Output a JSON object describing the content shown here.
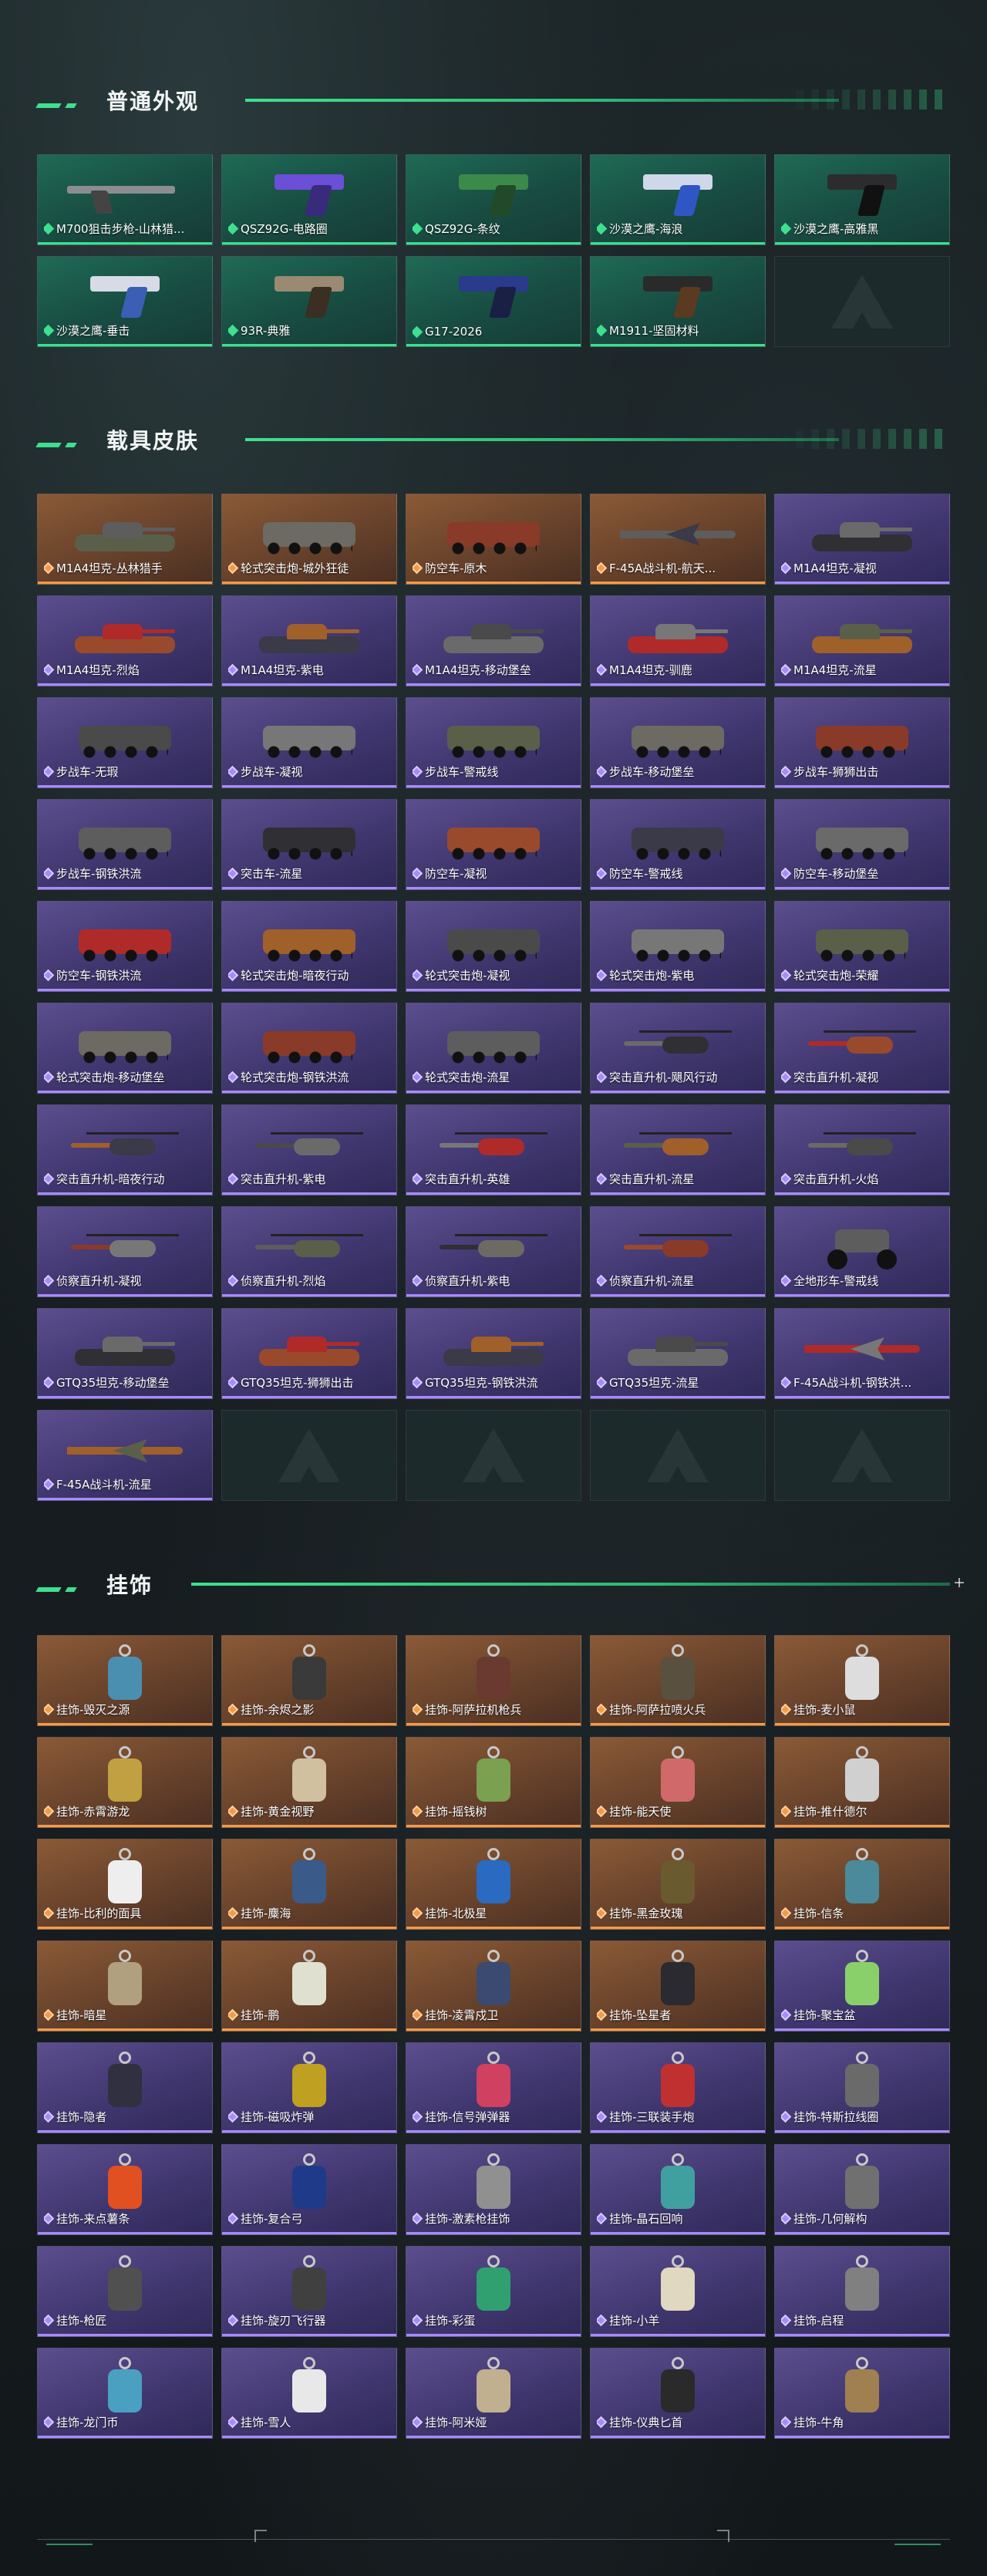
{
  "sections": {
    "weapon_skins": {
      "title": "普通外观",
      "items": [
        "M700狙击步枪-山林猎...",
        "QSZ92G-电路圈",
        "QSZ92G-条纹",
        "沙漠之鹰-海浪",
        "沙漠之鹰-高雅黑",
        "沙漠之鹰-垂击",
        "93R-典雅",
        "G17-2026",
        "M1911-坚固材料"
      ]
    },
    "vehicle_skins": {
      "title": "载具皮肤",
      "items": [
        {
          "label": "M1A4坦克-丛林猎手",
          "rarity": "orange"
        },
        {
          "label": "轮式突击炮-城外狂徒",
          "rarity": "orange"
        },
        {
          "label": "防空车-原木",
          "rarity": "orange"
        },
        {
          "label": "F-45A战斗机-航天...",
          "rarity": "orange"
        },
        {
          "label": "M1A4坦克-凝视",
          "rarity": "purple"
        },
        {
          "label": "M1A4坦克-烈焰",
          "rarity": "purple"
        },
        {
          "label": "M1A4坦克-紫电",
          "rarity": "purple"
        },
        {
          "label": "M1A4坦克-移动堡垒",
          "rarity": "purple"
        },
        {
          "label": "M1A4坦克-驯鹿",
          "rarity": "purple"
        },
        {
          "label": "M1A4坦克-流星",
          "rarity": "purple"
        },
        {
          "label": "步战车-无瑕",
          "rarity": "purple"
        },
        {
          "label": "步战车-凝视",
          "rarity": "purple"
        },
        {
          "label": "步战车-警戒线",
          "rarity": "purple"
        },
        {
          "label": "步战车-移动堡垒",
          "rarity": "purple"
        },
        {
          "label": "步战车-狮狮出击",
          "rarity": "purple"
        },
        {
          "label": "步战车-钢铁洪流",
          "rarity": "purple"
        },
        {
          "label": "突击车-流星",
          "rarity": "purple"
        },
        {
          "label": "防空车-凝视",
          "rarity": "purple"
        },
        {
          "label": "防空车-警戒线",
          "rarity": "purple"
        },
        {
          "label": "防空车-移动堡垒",
          "rarity": "purple"
        },
        {
          "label": "防空车-钢铁洪流",
          "rarity": "purple"
        },
        {
          "label": "轮式突击炮-暗夜行动",
          "rarity": "purple"
        },
        {
          "label": "轮式突击炮-凝视",
          "rarity": "purple"
        },
        {
          "label": "轮式突击炮-紫电",
          "rarity": "purple"
        },
        {
          "label": "轮式突击炮-荣耀",
          "rarity": "purple"
        },
        {
          "label": "轮式突击炮-移动堡垒",
          "rarity": "purple"
        },
        {
          "label": "轮式突击炮-钢铁洪流",
          "rarity": "purple"
        },
        {
          "label": "轮式突击炮-流星",
          "rarity": "purple"
        },
        {
          "label": "突击直升机-飓风行动",
          "rarity": "purple"
        },
        {
          "label": "突击直升机-凝视",
          "rarity": "purple"
        },
        {
          "label": "突击直升机-暗夜行动",
          "rarity": "purple"
        },
        {
          "label": "突击直升机-紫电",
          "rarity": "purple"
        },
        {
          "label": "突击直升机-英雄",
          "rarity": "purple"
        },
        {
          "label": "突击直升机-流星",
          "rarity": "purple"
        },
        {
          "label": "突击直升机-火焰",
          "rarity": "purple"
        },
        {
          "label": "侦察直升机-凝视",
          "rarity": "purple"
        },
        {
          "label": "侦察直升机-烈焰",
          "rarity": "purple"
        },
        {
          "label": "侦察直升机-紫电",
          "rarity": "purple"
        },
        {
          "label": "侦察直升机-流星",
          "rarity": "purple"
        },
        {
          "label": "全地形车-警戒线",
          "rarity": "purple"
        },
        {
          "label": "GTQ35坦克-移动堡垒",
          "rarity": "purple"
        },
        {
          "label": "GTQ35坦克-狮狮出击",
          "rarity": "purple"
        },
        {
          "label": "GTQ35坦克-钢铁洪流",
          "rarity": "purple"
        },
        {
          "label": "GTQ35坦克-流星",
          "rarity": "purple"
        },
        {
          "label": "F-45A战斗机-钢铁洪...",
          "rarity": "purple"
        },
        {
          "label": "F-45A战斗机-流星",
          "rarity": "purple"
        }
      ]
    },
    "charms": {
      "title": "挂饰",
      "items": [
        {
          "label": "挂饰-毁灭之源",
          "rarity": "orange"
        },
        {
          "label": "挂饰-余烬之影",
          "rarity": "orange"
        },
        {
          "label": "挂饰-阿萨拉机枪兵",
          "rarity": "orange"
        },
        {
          "label": "挂饰-阿萨拉喷火兵",
          "rarity": "orange"
        },
        {
          "label": "挂饰-麦小鼠",
          "rarity": "orange"
        },
        {
          "label": "挂饰-赤霄游龙",
          "rarity": "orange"
        },
        {
          "label": "挂饰-黄金视野",
          "rarity": "orange"
        },
        {
          "label": "挂饰-摇钱树",
          "rarity": "orange"
        },
        {
          "label": "挂饰-能天使",
          "rarity": "orange"
        },
        {
          "label": "挂饰-推什德尔",
          "rarity": "orange"
        },
        {
          "label": "挂饰-比利的面具",
          "rarity": "orange"
        },
        {
          "label": "挂饰-麋海",
          "rarity": "orange"
        },
        {
          "label": "挂饰-北极星",
          "rarity": "orange"
        },
        {
          "label": "挂饰-黑金玫瑰",
          "rarity": "orange"
        },
        {
          "label": "挂饰-信条",
          "rarity": "orange"
        },
        {
          "label": "挂饰-暗星",
          "rarity": "orange"
        },
        {
          "label": "挂饰-鹏",
          "rarity": "orange"
        },
        {
          "label": "挂饰-凌霄戍卫",
          "rarity": "orange"
        },
        {
          "label": "挂饰-坠星者",
          "rarity": "orange"
        },
        {
          "label": "挂饰-聚宝盆",
          "rarity": "purple"
        },
        {
          "label": "挂饰-隐者",
          "rarity": "purple"
        },
        {
          "label": "挂饰-磁吸炸弹",
          "rarity": "purple"
        },
        {
          "label": "挂饰-信号弹弹器",
          "rarity": "purple"
        },
        {
          "label": "挂饰-三联装手炮",
          "rarity": "purple"
        },
        {
          "label": "挂饰-特斯拉线圈",
          "rarity": "purple"
        },
        {
          "label": "挂饰-来点薯条",
          "rarity": "purple"
        },
        {
          "label": "挂饰-复合弓",
          "rarity": "purple"
        },
        {
          "label": "挂饰-激素枪挂饰",
          "rarity": "purple"
        },
        {
          "label": "挂饰-晶石回响",
          "rarity": "purple"
        },
        {
          "label": "挂饰-几何解构",
          "rarity": "purple"
        },
        {
          "label": "挂饰-枪匠",
          "rarity": "purple"
        },
        {
          "label": "挂饰-旋刃飞行器",
          "rarity": "purple"
        },
        {
          "label": "挂饰-彩蛋",
          "rarity": "purple"
        },
        {
          "label": "挂饰-小羊",
          "rarity": "purple"
        },
        {
          "label": "挂饰-启程",
          "rarity": "purple"
        },
        {
          "label": "挂饰-龙门币",
          "rarity": "purple"
        },
        {
          "label": "挂饰-雪人",
          "rarity": "purple"
        },
        {
          "label": "挂饰-阿米娅",
          "rarity": "purple"
        },
        {
          "label": "挂饰-仪典匕首",
          "rarity": "purple"
        },
        {
          "label": "挂饰-牛角",
          "rarity": "purple"
        }
      ]
    }
  },
  "colors": {
    "accent": "#3ee08f",
    "rarity_orange": "#f39a4a",
    "rarity_purple": "#a78bfa"
  }
}
